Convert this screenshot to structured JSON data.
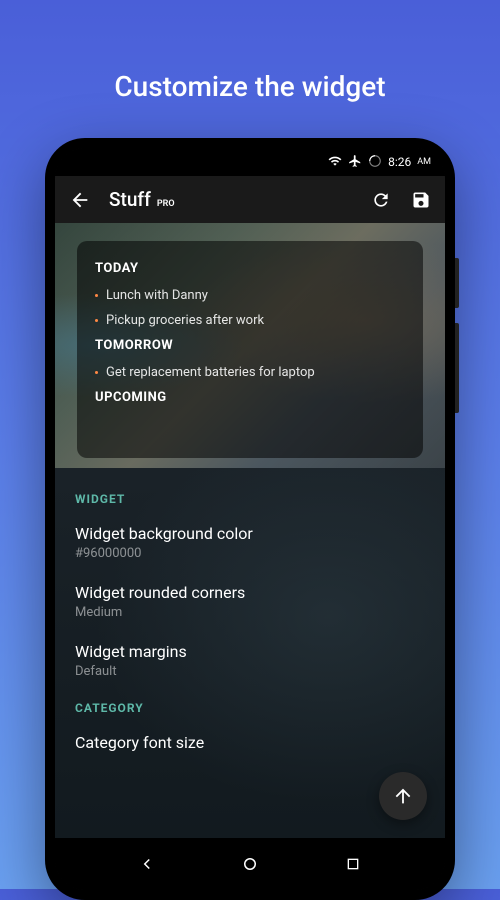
{
  "hero_title": "Customize the widget",
  "status_bar": {
    "time": "8:26",
    "time_period": "AM"
  },
  "app_bar": {
    "title": "Stuff",
    "badge": "PRO"
  },
  "widget_preview": {
    "sections": [
      {
        "title": "TODAY",
        "items": [
          "Lunch with Danny",
          "Pickup groceries after work"
        ]
      },
      {
        "title": "TOMORROW",
        "items": [
          "Get replacement batteries for laptop"
        ]
      },
      {
        "title": "UPCOMING",
        "items": []
      }
    ]
  },
  "settings": {
    "sections": [
      {
        "header": "WIDGET",
        "items": [
          {
            "title": "Widget background color",
            "value": "#96000000"
          },
          {
            "title": "Widget rounded corners",
            "value": "Medium"
          },
          {
            "title": "Widget margins",
            "value": "Default"
          }
        ]
      },
      {
        "header": "CATEGORY",
        "items": [
          {
            "title": "Category font size",
            "value": ""
          }
        ]
      }
    ]
  }
}
